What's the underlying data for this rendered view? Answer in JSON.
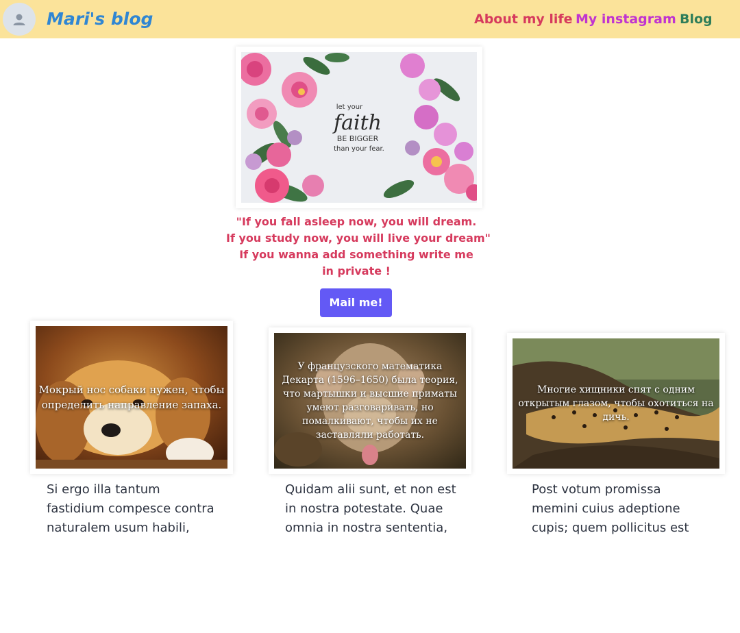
{
  "header": {
    "brand": "Mari's blog",
    "nav": [
      {
        "label": "About my life",
        "color": "#d63a5d"
      },
      {
        "label": "My instagram",
        "color": "#c034d0"
      },
      {
        "label": "Blog",
        "color": "#2e7d59"
      }
    ],
    "background": "#fbe39a"
  },
  "hero": {
    "image_text": [
      "let your",
      "faith",
      "BE BIGGER",
      "than your fear."
    ],
    "quote_lines": [
      "\"If you fall asleep now, you will dream.",
      "If you study now, you will live your dream\"",
      "If you wanna add something write me",
      "in private !"
    ],
    "button_label": "Mail me!"
  },
  "cards": [
    {
      "image": "puppy",
      "overlay": "Мокрый нос собаки нужен, чтобы определить направление запаха.",
      "text": "Si ergo illa tantum\nfastidium compesce contra\nnaturalem usum habili,"
    },
    {
      "image": "monkey",
      "overlay": "У французского математика Декарта (1596–1650) была теория, что мартышки и высшие приматы умеют разговаривать, но помалкивают, чтобы их не заставляли работать.",
      "text": "Quidam alii sunt, et non est\nin nostra potestate. Quae\nomnia in nostra sententia,"
    },
    {
      "image": "leopard",
      "overlay": "Многие хищники спят с одним открытым глазом, чтобы охотиться на дичь.",
      "text": "Post votum promissa\nmemini cuius adeptione\ncupis; quem pollicitus est"
    }
  ],
  "colors": {
    "accent_button": "#6359f5",
    "quote": "#d63a5d",
    "brand": "#2f86d3"
  }
}
